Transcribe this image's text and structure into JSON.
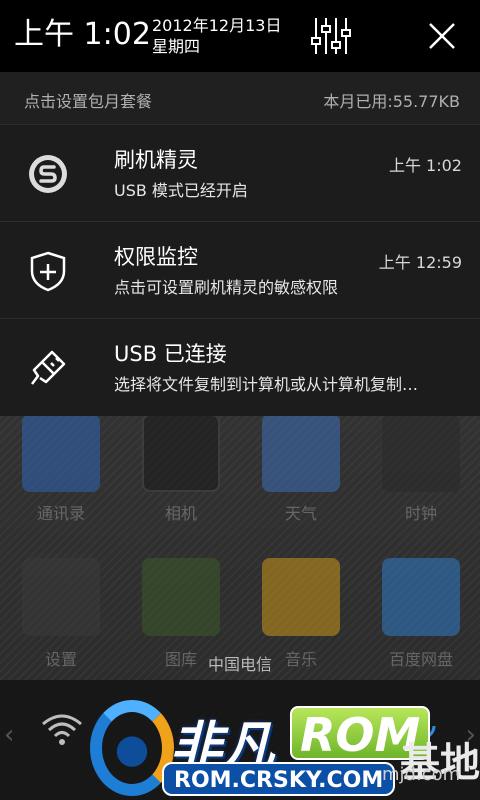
{
  "header": {
    "time": "上午 1:02",
    "date": "2012年12月13日",
    "weekday": "星期四"
  },
  "data_bar": {
    "left": "点击设置包月套餐",
    "right": "本月已用:55.77KB"
  },
  "notifications": [
    {
      "title": "刷机精灵",
      "text": "USB 模式已经开启",
      "time": "上午 1:02",
      "icon": "shuaji-logo-icon"
    },
    {
      "title": "权限监控",
      "text": "点击可设置刷机精灵的敏感权限",
      "time": "上午 12:59",
      "icon": "shield-plus-icon"
    },
    {
      "title": "USB 已连接",
      "text": "选择将文件复制到计算机或从计算机复制…",
      "time": "",
      "icon": "usb-plug-icon"
    }
  ],
  "home": {
    "carrier": "中国电信",
    "icons": [
      {
        "label": "通讯录",
        "icon": "contacts-icon"
      },
      {
        "label": "相机",
        "icon": "camera-icon"
      },
      {
        "label": "天气",
        "icon": "weather-icon"
      },
      {
        "label": "时钟",
        "icon": "clock-icon"
      },
      {
        "label": "设置",
        "icon": "settings-app-icon"
      },
      {
        "label": "图库",
        "icon": "gallery-icon"
      },
      {
        "label": "音乐",
        "icon": "music-icon"
      },
      {
        "label": "百度网盘",
        "icon": "cloud-drive-icon"
      }
    ]
  },
  "watermark": {
    "brand": "非凡",
    "rom": "ROM",
    "suffix": "基地",
    "url": "ROM.CRSKY.COM",
    "url2": "mjd.com"
  },
  "colors": {
    "shade_bg": "#1c1c1c",
    "header_bg": "#000000",
    "watermark_blue": "#0b4fa6",
    "watermark_green": "#8cc63f"
  }
}
